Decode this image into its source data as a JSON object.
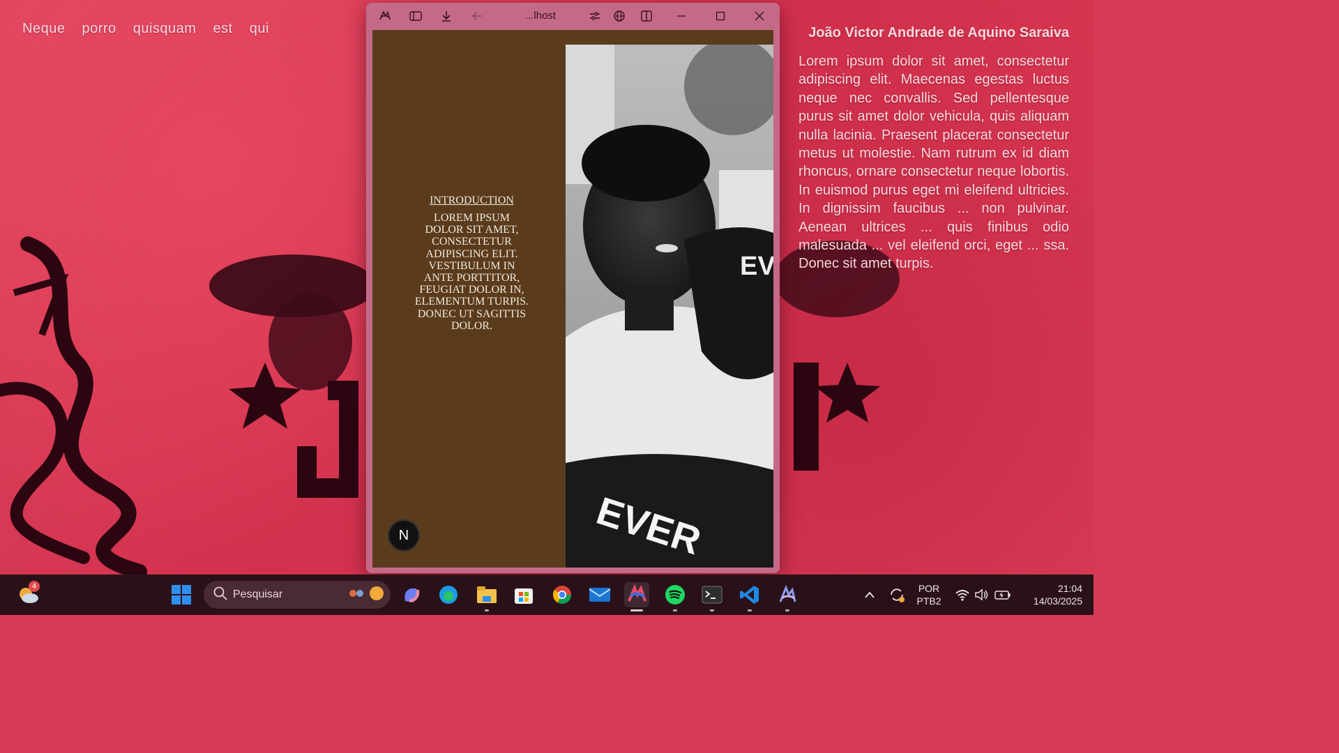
{
  "wallpaper": {
    "heading_words": "Neque porro quisquam est qui",
    "author_name": "João Victor Andrade de Aquino Saraiva",
    "paragraph": "Lorem ipsum dolor sit amet, consectetur adipiscing elit. Maecenas egestas luctus neque nec convallis. Sed pellentesque purus sit amet dolor vehicula, quis aliquam nulla lacinia. Praesent placerat consectetur metus ut molestie. Nam rutrum ex id diam rhoncus, ornare consectetur neque lobortis. In euismod purus eget mi eleifend ultricies. In dignissim faucibus ... non pulvinar. Aenean ultrices ... quis finibus odio malesuada ... vel eleifend orci, eget ... ssa. Donec sit amet turpis."
  },
  "window": {
    "title": "...lhost",
    "controls": {
      "minimize_icon": "minimize-icon",
      "maximize_icon": "maximize-icon",
      "close_icon": "close-icon"
    },
    "toolbar_icons": [
      "app-logo-icon",
      "sidebar-toggle-icon",
      "download-icon",
      "back-arrow-icon",
      "tune-icon",
      "globe-icon",
      "split-view-icon"
    ]
  },
  "page": {
    "intro_title": "INTRODUCTION",
    "intro_body": "LOREM IPSUM DOLOR SIT AMET, CONSECTETUR ADIPISCING ELIT. VESTIBULUM IN ANTE PORTTITOR, FEUGIAT DOLOR IN, ELEMENTUM TURPIS. DONEC UT SAGITTIS DOLOR.",
    "next_badge": "N",
    "photo_text": "EV",
    "glove_text": "EVER",
    "background_color": "#5a3c1c"
  },
  "taskbar": {
    "widgets_badge": "4",
    "search_placeholder": "Pesquisar",
    "apps": [
      "start-icon",
      "copilot-icon",
      "edge-icon",
      "file-explorer-icon",
      "store-icon",
      "chrome-icon",
      "mail-icon",
      "arc-browser-icon",
      "spotify-icon",
      "terminal-icon",
      "vscode-icon",
      "git-kraken-icon"
    ],
    "language": "POR",
    "keyboard": "PTB2",
    "time": "21:04",
    "date": "14/03/2025"
  },
  "colors": {
    "wallpaper": "#d63a55",
    "window_frame": "#c46a88",
    "page_bg": "#5a3c1c",
    "taskbar": "#2a1119"
  }
}
